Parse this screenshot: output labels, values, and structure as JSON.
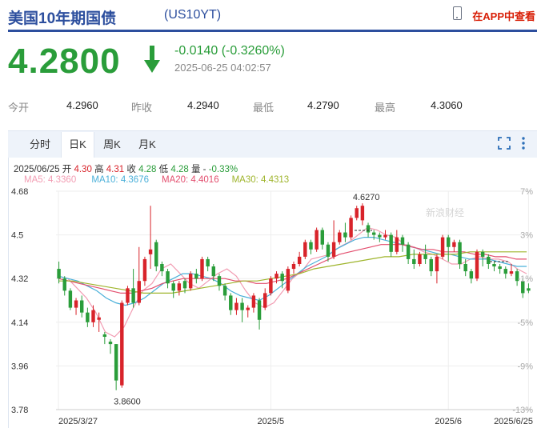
{
  "header": {
    "title": "美国10年期国债",
    "code": "(US10YT)",
    "app_link": "在APP中查看",
    "phone_icon": "phone-icon"
  },
  "quote": {
    "price": "4.2800",
    "change": "-0.0140 (-0.3260%)",
    "time": "2025-06-25 04:02:57",
    "direction": "down",
    "color": "#2a9d3a"
  },
  "stats": [
    {
      "label": "今开",
      "value": "4.2960"
    },
    {
      "label": "昨收",
      "value": "4.2940"
    },
    {
      "label": "最低",
      "value": "4.2790"
    },
    {
      "label": "最高",
      "value": "4.3060"
    }
  ],
  "tabs": [
    {
      "label": "分时",
      "active": false
    },
    {
      "label": "日K",
      "active": true
    },
    {
      "label": "周K",
      "active": false
    },
    {
      "label": "月K",
      "active": false
    }
  ],
  "toolbar_icons": [
    "fullscreen-icon",
    "more-vertical-icon"
  ],
  "info": {
    "date": "2025/06/25",
    "open_l": "开",
    "open": "4.30",
    "high_l": "高",
    "high": "4.31",
    "close_l": "收",
    "close": "4.28",
    "low_l": "低",
    "low": "4.28",
    "vol_l": "量",
    "vol": "-",
    "pct": "-0.33%"
  },
  "ma": [
    {
      "label": "MA5: 4.3360",
      "color": "#f29cb2"
    },
    {
      "label": "MA10: 4.3676",
      "color": "#4ab0d9"
    },
    {
      "label": "MA20: 4.4016",
      "color": "#e34f6f"
    },
    {
      "label": "MA30: 4.4313",
      "color": "#9fb52d"
    }
  ],
  "watermark": "新浪财经",
  "chart_data": {
    "type": "candlestick",
    "yticks": [
      "4.68",
      "4.5",
      "4.32",
      "4.14",
      "3.96",
      "3.78"
    ],
    "ylim": [
      3.78,
      4.68
    ],
    "pct_ticks": [
      "7%",
      "3%",
      "-1%",
      "-5%",
      "-9%",
      "-13%"
    ],
    "xticks": [
      "2025/3/27",
      "2025/5",
      "2025/6",
      "2025/6/25"
    ],
    "annotations": [
      {
        "text": "4.6270",
        "kind": "max"
      },
      {
        "text": "3.8600",
        "kind": "min"
      }
    ],
    "up_color": "#d8232a",
    "down_color": "#2a9d3a",
    "candles": [
      [
        4.36,
        4.32,
        4.3,
        4.39
      ],
      [
        4.32,
        4.27,
        4.25,
        4.33
      ],
      [
        4.27,
        4.2,
        4.19,
        4.28
      ],
      [
        4.2,
        4.23,
        4.17,
        4.24
      ],
      [
        4.23,
        4.18,
        4.16,
        4.25
      ],
      [
        4.18,
        4.14,
        4.12,
        4.2
      ],
      [
        4.14,
        4.19,
        4.12,
        4.21
      ],
      [
        4.15,
        4.16,
        4.1,
        4.18
      ],
      [
        4.09,
        4.08,
        4.05,
        4.1
      ],
      [
        4.06,
        4.05,
        4.01,
        4.07
      ],
      [
        4.05,
        3.9,
        3.86,
        4.05
      ],
      [
        3.88,
        4.22,
        3.87,
        4.23
      ],
      [
        4.22,
        4.28,
        4.21,
        4.29
      ],
      [
        4.28,
        4.22,
        4.2,
        4.36
      ],
      [
        4.22,
        4.31,
        4.21,
        4.45
      ],
      [
        4.31,
        4.4,
        4.29,
        4.41
      ],
      [
        4.42,
        4.44,
        4.36,
        4.62
      ],
      [
        4.47,
        4.37,
        4.35,
        4.48
      ],
      [
        4.38,
        4.35,
        4.33,
        4.39
      ],
      [
        4.35,
        4.3,
        4.28,
        4.36
      ],
      [
        4.3,
        4.27,
        4.24,
        4.31
      ],
      [
        4.27,
        4.3,
        4.25,
        4.31
      ],
      [
        4.31,
        4.28,
        4.26,
        4.32
      ],
      [
        4.28,
        4.34,
        4.27,
        4.35
      ],
      [
        4.34,
        4.32,
        4.3,
        4.36
      ],
      [
        4.32,
        4.4,
        4.31,
        4.41
      ],
      [
        4.4,
        4.37,
        4.35,
        4.41
      ],
      [
        4.37,
        4.33,
        4.31,
        4.38
      ],
      [
        4.33,
        4.29,
        4.27,
        4.34
      ],
      [
        4.29,
        4.25,
        4.23,
        4.3
      ],
      [
        4.25,
        4.19,
        4.17,
        4.26
      ],
      [
        4.19,
        4.22,
        4.17,
        4.24
      ],
      [
        4.22,
        4.19,
        4.14,
        4.24
      ],
      [
        4.19,
        4.2,
        4.16,
        4.21
      ],
      [
        4.2,
        4.25,
        4.18,
        4.26
      ],
      [
        4.23,
        4.15,
        4.11,
        4.24
      ],
      [
        4.2,
        4.26,
        4.19,
        4.28
      ],
      [
        4.26,
        4.32,
        4.25,
        4.33
      ],
      [
        4.32,
        4.34,
        4.3,
        4.35
      ],
      [
        4.34,
        4.31,
        4.28,
        4.35
      ],
      [
        4.27,
        4.36,
        4.26,
        4.37
      ],
      [
        4.36,
        4.38,
        4.34,
        4.39
      ],
      [
        4.38,
        4.41,
        4.37,
        4.43
      ],
      [
        4.41,
        4.47,
        4.4,
        4.48
      ],
      [
        4.47,
        4.44,
        4.42,
        4.48
      ],
      [
        4.44,
        4.52,
        4.43,
        4.53
      ],
      [
        4.52,
        4.46,
        4.44,
        4.53
      ],
      [
        4.46,
        4.41,
        4.39,
        4.47
      ],
      [
        4.41,
        4.47,
        4.4,
        4.56
      ],
      [
        4.47,
        4.51,
        4.46,
        4.52
      ],
      [
        4.51,
        4.49,
        4.47,
        4.55
      ],
      [
        4.49,
        4.57,
        4.48,
        4.58
      ],
      [
        4.57,
        4.61,
        4.56,
        4.62
      ],
      [
        4.56,
        4.62,
        4.54,
        4.63
      ],
      [
        4.54,
        4.51,
        4.49,
        4.55
      ],
      [
        4.51,
        4.5,
        4.48,
        4.52
      ],
      [
        4.5,
        4.49,
        4.47,
        4.51
      ],
      [
        4.49,
        4.5,
        4.48,
        4.52
      ],
      [
        4.5,
        4.43,
        4.41,
        4.51
      ],
      [
        4.43,
        4.49,
        4.42,
        4.52
      ],
      [
        4.49,
        4.46,
        4.43,
        4.5
      ],
      [
        4.46,
        4.4,
        4.38,
        4.47
      ],
      [
        4.4,
        4.38,
        4.36,
        4.44
      ],
      [
        4.38,
        4.42,
        4.37,
        4.43
      ],
      [
        4.42,
        4.4,
        4.38,
        4.46
      ],
      [
        4.4,
        4.35,
        4.33,
        4.41
      ],
      [
        4.35,
        4.41,
        4.3,
        4.42
      ],
      [
        4.41,
        4.49,
        4.4,
        4.5
      ],
      [
        4.49,
        4.45,
        4.39,
        4.5
      ],
      [
        4.45,
        4.47,
        4.43,
        4.48
      ],
      [
        4.47,
        4.38,
        4.36,
        4.48
      ],
      [
        4.38,
        4.35,
        4.33,
        4.4
      ],
      [
        4.35,
        4.32,
        4.3,
        4.36
      ],
      [
        4.32,
        4.43,
        4.31,
        4.44
      ],
      [
        4.43,
        4.41,
        4.37,
        4.44
      ],
      [
        4.41,
        4.38,
        4.36,
        4.42
      ],
      [
        4.38,
        4.37,
        4.35,
        4.39
      ],
      [
        4.37,
        4.36,
        4.34,
        4.38
      ],
      [
        4.36,
        4.34,
        4.32,
        4.37
      ],
      [
        4.34,
        4.35,
        4.33,
        4.38
      ],
      [
        4.35,
        4.31,
        4.29,
        4.36
      ],
      [
        4.31,
        4.26,
        4.24,
        4.32
      ],
      [
        4.28,
        4.27,
        4.26,
        4.3
      ]
    ],
    "ma_series": {
      "MA5": [
        4.33,
        4.32,
        4.28,
        4.24,
        4.18,
        4.1,
        4.08,
        4.12,
        4.2,
        4.27,
        4.3,
        4.36,
        4.38,
        4.34,
        4.3,
        4.28,
        4.31,
        4.34,
        4.36,
        4.33,
        4.27,
        4.22,
        4.2,
        4.22,
        4.27,
        4.32,
        4.35,
        4.4,
        4.41,
        4.42,
        4.45,
        4.47,
        4.5,
        4.53,
        4.52,
        4.5,
        4.49,
        4.46,
        4.45,
        4.43,
        4.42,
        4.4,
        4.38,
        4.38,
        4.4,
        4.41,
        4.4,
        4.4,
        4.39,
        4.36,
        4.34
      ],
      "MA10": [
        4.33,
        4.32,
        4.31,
        4.29,
        4.27,
        4.24,
        4.22,
        4.21,
        4.22,
        4.24,
        4.27,
        4.3,
        4.32,
        4.34,
        4.34,
        4.33,
        4.32,
        4.3,
        4.27,
        4.25,
        4.24,
        4.23,
        4.25,
        4.28,
        4.31,
        4.34,
        4.37,
        4.39,
        4.41,
        4.44,
        4.46,
        4.48,
        4.49,
        4.49,
        4.48,
        4.47,
        4.46,
        4.45,
        4.44,
        4.43,
        4.42,
        4.42,
        4.41,
        4.4,
        4.4,
        4.4,
        4.39,
        4.38,
        4.37,
        4.37
      ],
      "MA20": [
        4.32,
        4.31,
        4.3,
        4.29,
        4.28,
        4.27,
        4.26,
        4.26,
        4.27,
        4.28,
        4.3,
        4.31,
        4.32,
        4.32,
        4.32,
        4.32,
        4.32,
        4.31,
        4.31,
        4.3,
        4.3,
        4.31,
        4.32,
        4.34,
        4.36,
        4.38,
        4.4,
        4.42,
        4.43,
        4.44,
        4.45,
        4.46,
        4.46,
        4.46,
        4.45,
        4.44,
        4.44,
        4.43,
        4.43,
        4.43,
        4.42,
        4.42,
        4.41,
        4.41,
        4.4,
        4.4
      ],
      "MA30": [
        4.31,
        4.31,
        4.3,
        4.29,
        4.28,
        4.27,
        4.26,
        4.26,
        4.26,
        4.27,
        4.28,
        4.29,
        4.3,
        4.31,
        4.31,
        4.32,
        4.33,
        4.34,
        4.36,
        4.37,
        4.38,
        4.39,
        4.4,
        4.41,
        4.41,
        4.42,
        4.42,
        4.42,
        4.42,
        4.43,
        4.43,
        4.43,
        4.43,
        4.43
      ]
    }
  }
}
